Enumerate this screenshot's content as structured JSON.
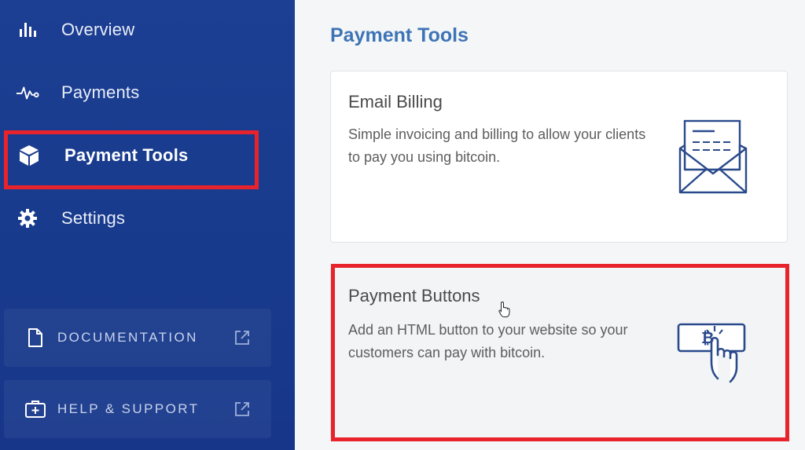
{
  "sidebar": {
    "items": [
      {
        "label": "Overview",
        "icon": "bar-chart-icon"
      },
      {
        "label": "Payments",
        "icon": "pulse-icon"
      },
      {
        "label": "Payment Tools",
        "icon": "cube-icon",
        "active": true
      },
      {
        "label": "Settings",
        "icon": "gear-icon"
      }
    ],
    "links": [
      {
        "label": "DOCUMENTATION",
        "icon": "document-icon"
      },
      {
        "label": "HELP & SUPPORT",
        "icon": "first-aid-icon"
      }
    ]
  },
  "main": {
    "title": "Payment Tools",
    "cards": [
      {
        "title": "Email Billing",
        "description": "Simple invoicing and billing to allow your clients to pay you using bitcoin.",
        "icon": "envelope-invoice-icon"
      },
      {
        "title": "Payment Buttons",
        "description": "Add an HTML button to your website so your customers can pay with bitcoin.",
        "icon": "bitcoin-button-icon",
        "button_glyph": "₿"
      }
    ]
  },
  "colors": {
    "sidebar_bg": "#1c3f93",
    "title_blue": "#3d74b5",
    "highlight_red": "#e8232b",
    "icon_navy": "#2a4a8c"
  }
}
